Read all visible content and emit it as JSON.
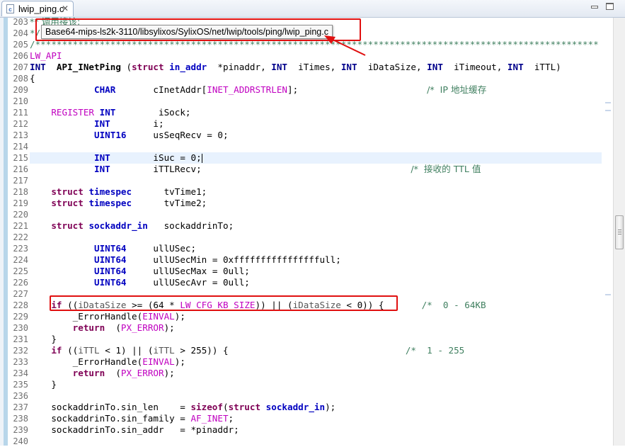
{
  "editor": {
    "tab_label": "lwip_ping.c",
    "tab_close": "✕",
    "tooltip": "Base64-mips-ls2k-3110/libsylixos/SylixOS/net/lwip/tools/ping/lwip_ping.c"
  },
  "colors": {
    "keyword": "#7f0055",
    "type": "#00008b",
    "macro": "#c000c0",
    "comment": "#3f7f5f",
    "annotation_red": "#e01010",
    "current_line": "#e8f2fe"
  },
  "lines": [
    {
      "n": "203",
      "t": [
        [
          "cmz",
          "** 调用接该:"
        ]
      ]
    },
    {
      "n": "204",
      "t": [
        [
          "cm",
          "*/"
        ]
      ]
    },
    {
      "n": "205",
      "t": [
        [
          "cm",
          "/*********************************************************************************************************"
        ]
      ]
    },
    {
      "n": "206",
      "t": [
        [
          "mc",
          "LW_API"
        ]
      ]
    },
    {
      "n": "207",
      "t": [
        [
          "ty",
          "INT"
        ],
        [
          "",
          ""
        ],
        [
          "fn",
          "  API_INetPing"
        ],
        [
          "",
          " ("
        ],
        [
          "kw",
          "struct"
        ],
        [
          "",
          " "
        ],
        [
          "ty2",
          "in_addr"
        ],
        [
          "",
          "  *pinaddr, "
        ],
        [
          "ty",
          "INT"
        ],
        [
          "",
          "  iTimes, "
        ],
        [
          "ty",
          "INT"
        ],
        [
          "",
          "  iDataSize, "
        ],
        [
          "ty",
          "INT"
        ],
        [
          "",
          "  iTimeout, "
        ],
        [
          "ty",
          "INT"
        ],
        [
          "",
          "  iTTL)"
        ]
      ]
    },
    {
      "n": "208",
      "t": [
        [
          "",
          "{"
        ]
      ]
    },
    {
      "n": "209",
      "t": [
        [
          "",
          "            "
        ],
        [
          "ty2",
          "CHAR"
        ],
        [
          "",
          "       cInetAddr["
        ],
        [
          "mc",
          "INET_ADDRSTRLEN"
        ],
        [
          "",
          "];"
        ],
        [
          "",
          "                        "
        ],
        [
          "cmz",
          "/*  IP 地址缓存"
        ]
      ]
    },
    {
      "n": "210",
      "t": [
        [
          "",
          ""
        ]
      ]
    },
    {
      "n": "211",
      "t": [
        [
          "",
          "    "
        ],
        [
          "mc",
          "REGISTER"
        ],
        [
          "",
          " "
        ],
        [
          "ty2",
          "INT"
        ],
        [
          "",
          "        iSock;"
        ]
      ]
    },
    {
      "n": "212",
      "t": [
        [
          "",
          "            "
        ],
        [
          "ty2",
          "INT"
        ],
        [
          "",
          "        i;"
        ]
      ]
    },
    {
      "n": "213",
      "t": [
        [
          "",
          "            "
        ],
        [
          "ty2",
          "UINT16"
        ],
        [
          "",
          "     usSeqRecv = 0;"
        ]
      ]
    },
    {
      "n": "214",
      "t": [
        [
          "",
          ""
        ]
      ]
    },
    {
      "n": "215",
      "t": [
        [
          "",
          "            "
        ],
        [
          "ty2",
          "INT"
        ],
        [
          "",
          "        iSuc = 0;"
        ]
      ],
      "current": true
    },
    {
      "n": "216",
      "t": [
        [
          "",
          "            "
        ],
        [
          "ty2",
          "INT"
        ],
        [
          "",
          "        iTTLRecv;"
        ],
        [
          "",
          "                                       "
        ],
        [
          "cmz",
          "/*  接收的 TTL 值"
        ]
      ]
    },
    {
      "n": "217",
      "t": [
        [
          "",
          ""
        ]
      ]
    },
    {
      "n": "218",
      "t": [
        [
          "",
          "    "
        ],
        [
          "kw",
          "struct"
        ],
        [
          "",
          " "
        ],
        [
          "ty2",
          "timespec"
        ],
        [
          "",
          "      tvTime1;"
        ]
      ]
    },
    {
      "n": "219",
      "t": [
        [
          "",
          "    "
        ],
        [
          "kw",
          "struct"
        ],
        [
          "",
          " "
        ],
        [
          "ty2",
          "timespec"
        ],
        [
          "",
          "      tvTime2;"
        ]
      ]
    },
    {
      "n": "220",
      "t": [
        [
          "",
          ""
        ]
      ]
    },
    {
      "n": "221",
      "t": [
        [
          "",
          "    "
        ],
        [
          "kw",
          "struct"
        ],
        [
          "",
          " "
        ],
        [
          "ty2",
          "sockaddr_in"
        ],
        [
          "",
          "   sockaddrinTo;"
        ]
      ]
    },
    {
      "n": "222",
      "t": [
        [
          "",
          ""
        ]
      ]
    },
    {
      "n": "223",
      "t": [
        [
          "",
          "            "
        ],
        [
          "ty2",
          "UINT64"
        ],
        [
          "",
          "     ullUSec;"
        ]
      ]
    },
    {
      "n": "224",
      "t": [
        [
          "",
          "            "
        ],
        [
          "ty2",
          "UINT64"
        ],
        [
          "",
          "     ullUSecMin = 0xffffffffffffffffull;"
        ]
      ]
    },
    {
      "n": "225",
      "t": [
        [
          "",
          "            "
        ],
        [
          "ty2",
          "UINT64"
        ],
        [
          "",
          "     ullUSecMax = 0ull;"
        ]
      ]
    },
    {
      "n": "226",
      "t": [
        [
          "",
          "            "
        ],
        [
          "ty2",
          "UINT64"
        ],
        [
          "",
          "     ullUSecAvr = 0ull;"
        ]
      ]
    },
    {
      "n": "227",
      "t": [
        [
          "",
          ""
        ]
      ]
    },
    {
      "n": "228",
      "t": [
        [
          "",
          "    "
        ],
        [
          "kw",
          "if"
        ],
        [
          "",
          " (("
        ],
        [
          "var",
          "iDataSize"
        ],
        [
          "",
          " >= (64 * "
        ],
        [
          "mc",
          "LW_CFG_KB_SIZE"
        ],
        [
          "",
          ")) || ("
        ],
        [
          "var",
          "iDataSize"
        ],
        [
          "",
          " < 0)) {"
        ],
        [
          "",
          "       "
        ],
        [
          "cm",
          "/*  0 - 64KB"
        ]
      ]
    },
    {
      "n": "229",
      "t": [
        [
          "",
          "        _ErrorHandle("
        ],
        [
          "mc",
          "EINVAL"
        ],
        [
          "",
          ");"
        ]
      ]
    },
    {
      "n": "230",
      "t": [
        [
          "",
          "        "
        ],
        [
          "kw",
          "return"
        ],
        [
          "",
          "  ("
        ],
        [
          "mc",
          "PX_ERROR"
        ],
        [
          "",
          ");"
        ]
      ]
    },
    {
      "n": "231",
      "t": [
        [
          "",
          "    }"
        ]
      ]
    },
    {
      "n": "232",
      "t": [
        [
          "",
          "    "
        ],
        [
          "kw",
          "if"
        ],
        [
          "",
          " (("
        ],
        [
          "var",
          "iTTL"
        ],
        [
          "",
          " < 1) || ("
        ],
        [
          "var",
          "iTTL"
        ],
        [
          "",
          " > 255)) {"
        ],
        [
          "",
          "                                 "
        ],
        [
          "cm",
          "/*  1 - 255"
        ]
      ]
    },
    {
      "n": "233",
      "t": [
        [
          "",
          "        _ErrorHandle("
        ],
        [
          "mc",
          "EINVAL"
        ],
        [
          "",
          ");"
        ]
      ]
    },
    {
      "n": "234",
      "t": [
        [
          "",
          "        "
        ],
        [
          "kw",
          "return"
        ],
        [
          "",
          "  ("
        ],
        [
          "mc",
          "PX_ERROR"
        ],
        [
          "",
          ");"
        ]
      ]
    },
    {
      "n": "235",
      "t": [
        [
          "",
          "    }"
        ]
      ]
    },
    {
      "n": "236",
      "t": [
        [
          "",
          ""
        ]
      ]
    },
    {
      "n": "237",
      "t": [
        [
          "",
          "    sockaddrinTo.sin_len    = "
        ],
        [
          "kw",
          "sizeof"
        ],
        [
          "",
          "("
        ],
        [
          "kw",
          "struct"
        ],
        [
          "",
          " "
        ],
        [
          "ty2",
          "sockaddr_in"
        ],
        [
          "",
          ");"
        ]
      ]
    },
    {
      "n": "238",
      "t": [
        [
          "",
          "    sockaddrinTo.sin_family = "
        ],
        [
          "mc",
          "AF_INET"
        ],
        [
          "",
          ";"
        ]
      ]
    },
    {
      "n": "239",
      "t": [
        [
          "",
          "    sockaddrinTo.sin_addr   = *pinaddr;"
        ]
      ]
    },
    {
      "n": "240",
      "t": [
        [
          "",
          ""
        ]
      ]
    }
  ]
}
